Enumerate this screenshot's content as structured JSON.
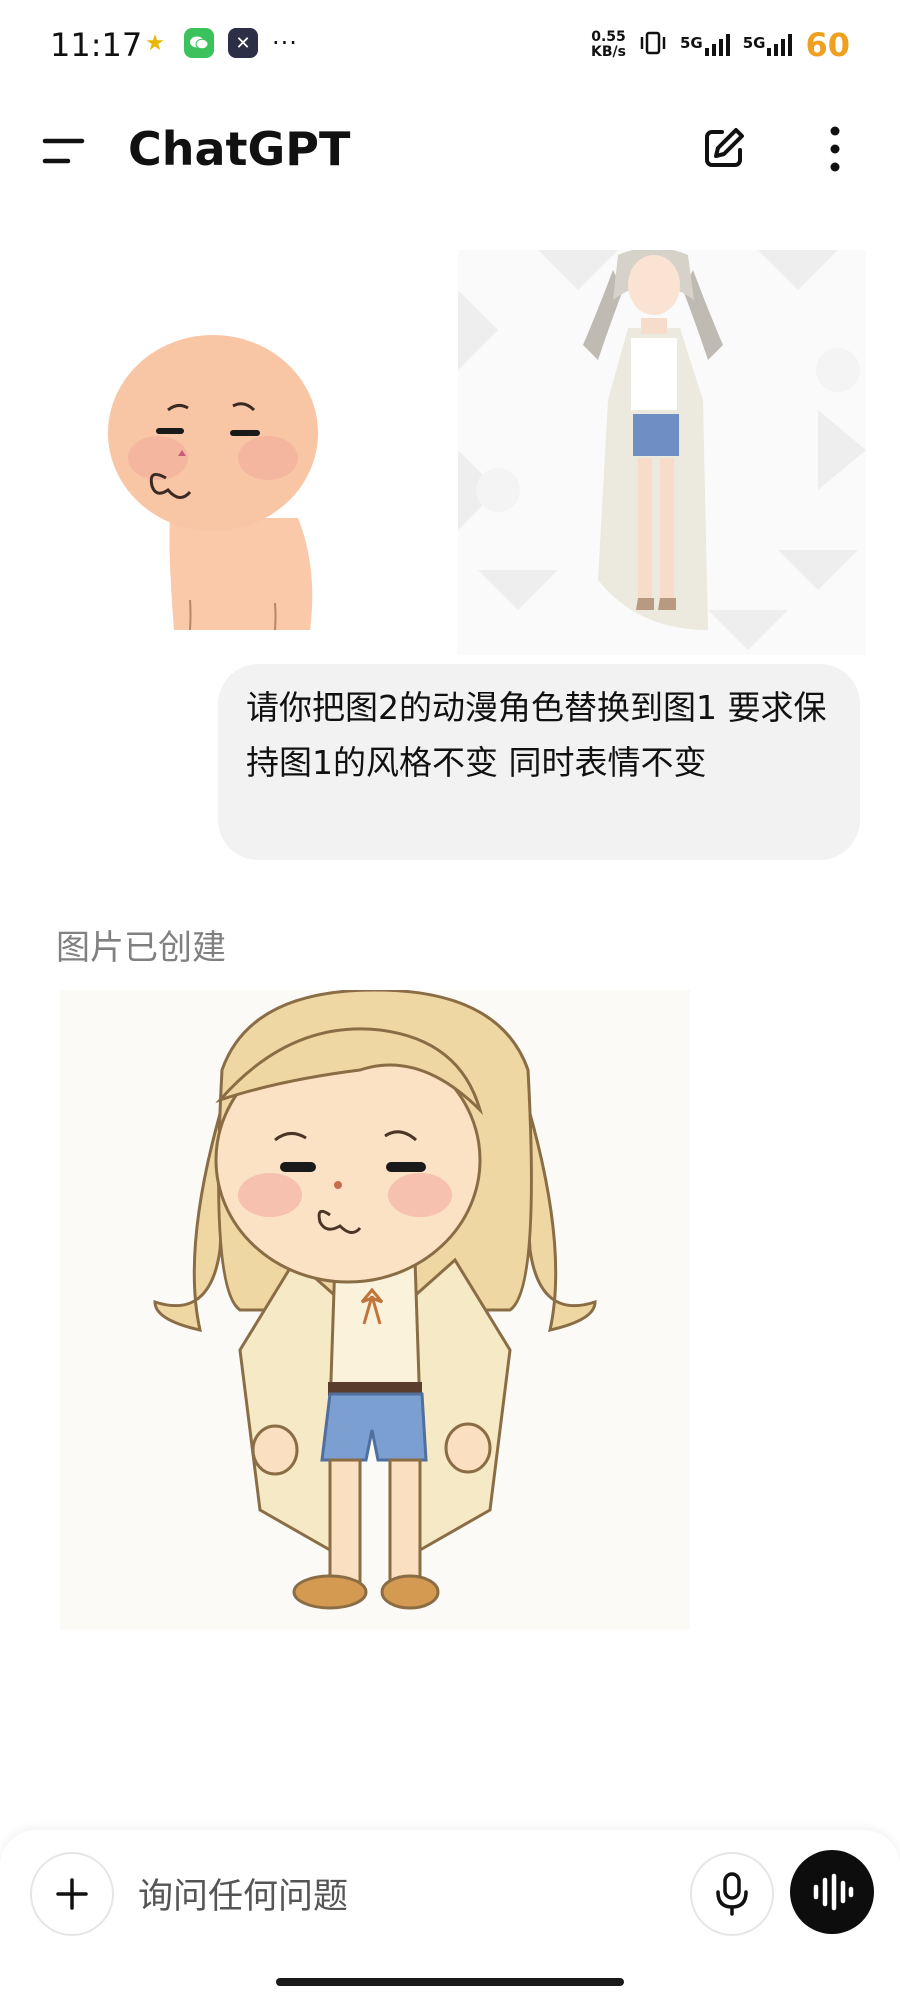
{
  "status_bar": {
    "time": "11:17",
    "more": "···",
    "net_speed_value": "0.55",
    "net_speed_unit": "KB/s",
    "signal_1": "5G",
    "signal_2": "5G",
    "battery": "60",
    "icons": [
      "notification-app-icon",
      "wechat-icon",
      "app-icon",
      "vibrate-icon"
    ]
  },
  "header": {
    "title": "ChatGPT",
    "icons": [
      "menu-icon",
      "new-chat-edit-icon",
      "more-vert-icon"
    ]
  },
  "conversation": {
    "user_message": "请你把图2的动漫角色替换到图1 要求保持图1的风格不变 同时表情不变",
    "assistant_status": "图片已创建"
  },
  "composer": {
    "placeholder": "询问任何问题",
    "icons": [
      "plus-icon",
      "microphone-icon",
      "voice-mode-icon"
    ]
  },
  "colors": {
    "accent_battery": "#f0a020",
    "bubble_bg": "#f2f2f2",
    "voice_button": "#0d0d0d"
  }
}
